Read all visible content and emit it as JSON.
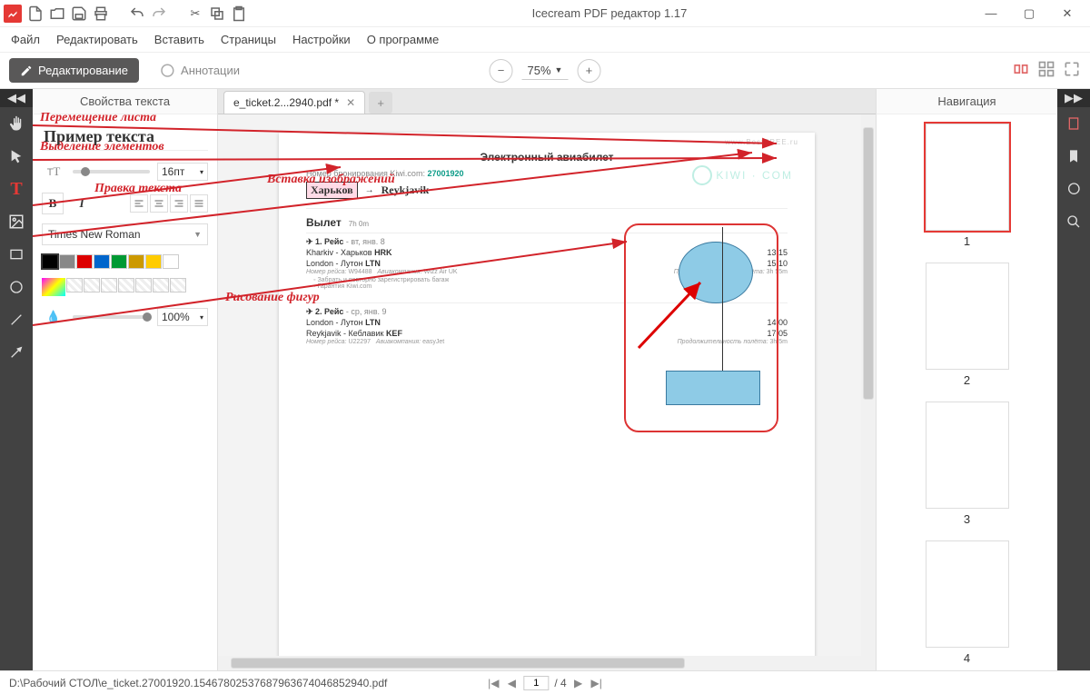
{
  "window": {
    "title": "Icecream PDF редактор 1.17"
  },
  "menu": [
    "Файл",
    "Редактировать",
    "Вставить",
    "Страницы",
    "Настройки",
    "О программе"
  ],
  "toolbar": {
    "edit": "Редактирование",
    "annotate": "Аннотации",
    "zoom": "75%"
  },
  "props": {
    "title": "Свойства текста",
    "sample": "Пример текста",
    "font_size": "16пт",
    "font": "Times New Roman",
    "opacity": "100%"
  },
  "tabs": {
    "file": "e_ticket.2...2940.pdf *"
  },
  "nav": {
    "title": "Навигация",
    "pages": [
      "1",
      "2",
      "3",
      "4"
    ]
  },
  "annotations": {
    "move": "Перемещение листа",
    "select": "Выделение элементов",
    "text": "Правка текста",
    "image": "Вставка изображений",
    "shapes": "Рисование фигур"
  },
  "doc": {
    "title": "Электронный авиабилет",
    "booking_label": "Номер бронирования Kiwi.com:",
    "booking_num": "27001920",
    "brand": "KIWI · COM",
    "watermark": "www.BestFREE.ru",
    "from": "Харьков",
    "to": "Reykjavik",
    "depart_label": "Вылет",
    "depart_dur": "7h 0m",
    "flight1": {
      "head": "1. Рейс",
      "date": "- вт, янв. 8",
      "r1a": "Kharkiv - Харьков",
      "r1code": "HRK",
      "r1t": "13:15",
      "r2a": "London - Лутон",
      "r2code": "LTN",
      "r2t": "15:10",
      "num_label": "Номер рейса:",
      "num": "W94488",
      "airline_label": "Авиакомпания:",
      "airline": "Wizz Air UK",
      "dur_label": "Продолжительность полёта:",
      "dur": "3h 55m",
      "b1": "Забрать и повторно зарегистрировать багаж",
      "b2": "Гарантия Kiwi.com"
    },
    "flight2": {
      "head": "2. Рейс",
      "date": "- ср, янв. 9",
      "r1a": "London - Лутон",
      "r1code": "LTN",
      "r1t": "14:00",
      "r2a": "Reykjavik - Кеблавик",
      "r2code": "KEF",
      "r2t": "17:05",
      "num_label": "Номер рейса:",
      "num": "U22297",
      "airline_label": "Авиакомпания:",
      "airline": "easyJet",
      "dur_label": "Продолжительность полёта:",
      "dur": "3h 5m"
    }
  },
  "status": {
    "path": "D:\\Рабочий СТОЛ\\e_ticket.27001920.15467802537687963674046852940.pdf",
    "page": "1",
    "total": "/ 4"
  }
}
